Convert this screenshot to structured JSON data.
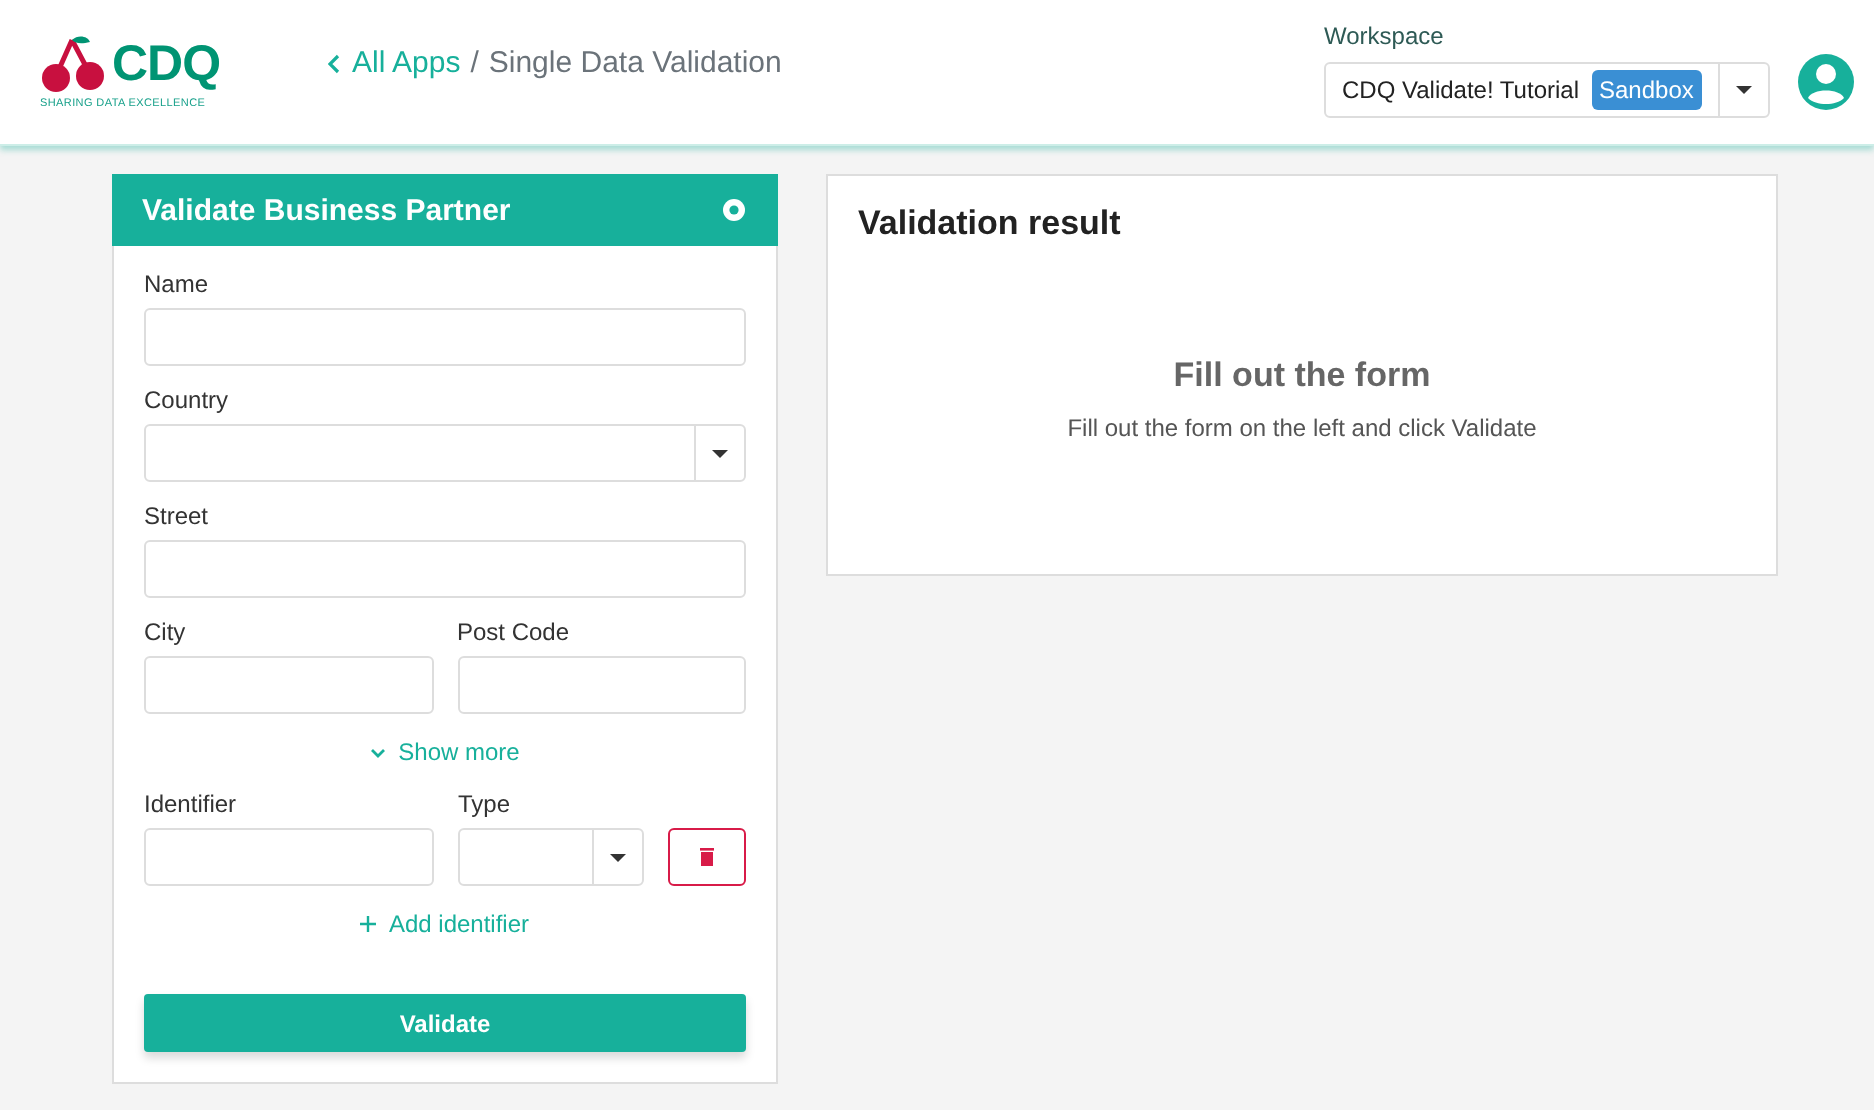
{
  "header": {
    "logo": {
      "wordmark": "CDQ",
      "tagline": "SHARING DATA EXCELLENCE"
    },
    "breadcrumb": {
      "link": "All Apps",
      "separator": "/",
      "current": "Single Data Validation"
    },
    "workspace": {
      "label": "Workspace",
      "value": "CDQ Validate! Tutorial",
      "badge": "Sandbox"
    }
  },
  "form": {
    "title": "Validate Business Partner",
    "rows": [
      {
        "fields": [
          {
            "label": "Name",
            "kind": "text"
          }
        ]
      },
      {
        "fields": [
          {
            "label": "Country",
            "kind": "select"
          }
        ]
      },
      {
        "fields": [
          {
            "label": "Street",
            "kind": "text"
          }
        ]
      },
      {
        "fields": [
          {
            "label": "City",
            "kind": "text"
          },
          {
            "label": "Post Code",
            "kind": "text"
          }
        ]
      }
    ],
    "show_more": "Show more",
    "identifier": {
      "fields": [
        {
          "label": "Identifier",
          "kind": "text"
        },
        {
          "label": "Type",
          "kind": "select"
        }
      ]
    },
    "add_identifier": "Add identifier",
    "submit": "Validate"
  },
  "result": {
    "title": "Validation result",
    "empty_title": "Fill out the form",
    "empty_text": "Fill out the form on the left and click Validate"
  }
}
